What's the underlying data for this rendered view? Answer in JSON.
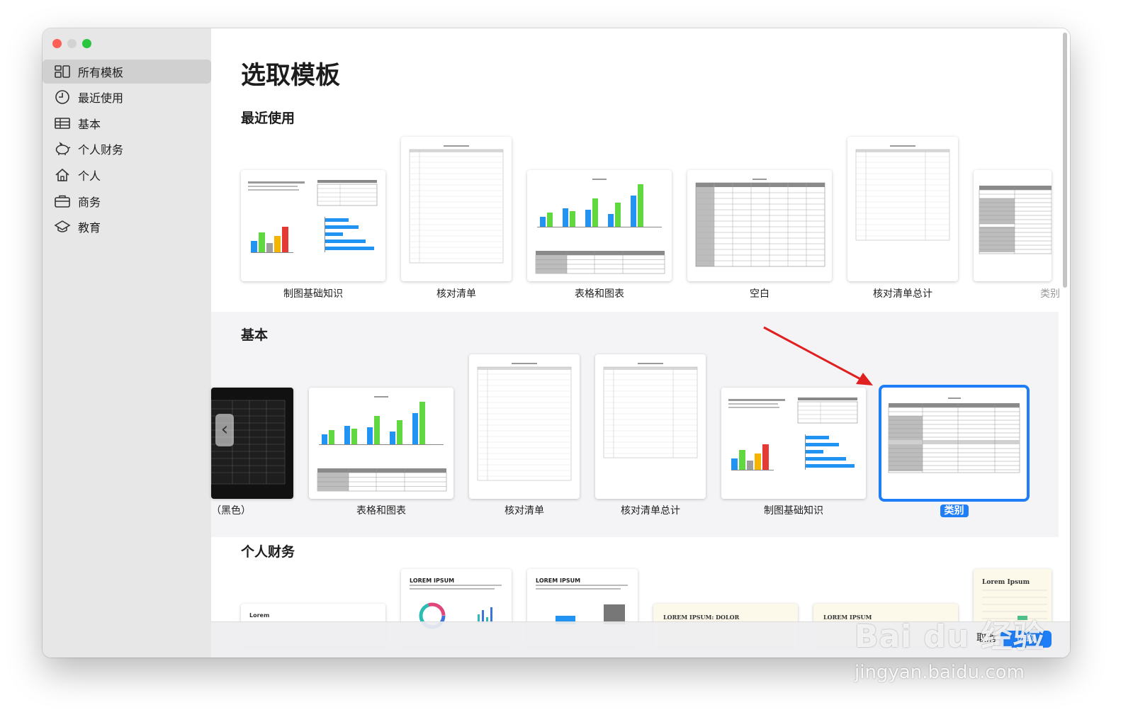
{
  "sidebar": {
    "items": [
      {
        "label": "所有模板",
        "icon": "grid-icon",
        "selected": true
      },
      {
        "label": "最近使用",
        "icon": "clock-icon",
        "selected": false
      },
      {
        "label": "基本",
        "icon": "table-icon",
        "selected": false
      },
      {
        "label": "个人财务",
        "icon": "piggy-bank-icon",
        "selected": false
      },
      {
        "label": "个人",
        "icon": "house-icon",
        "selected": false
      },
      {
        "label": "商务",
        "icon": "briefcase-icon",
        "selected": false
      },
      {
        "label": "教育",
        "icon": "graduation-cap-icon",
        "selected": false
      }
    ]
  },
  "main": {
    "title": "选取模板",
    "sections": {
      "recent": {
        "title": "最近使用",
        "templates": [
          "制图基础知识",
          "核对清单",
          "表格和图表",
          "空白",
          "核对清单总计",
          "类别"
        ]
      },
      "basic": {
        "title": "基本",
        "templates": [
          "（黑色）",
          "表格和图表",
          "核对清单",
          "核对清单总计",
          "制图基础知识",
          "类别"
        ],
        "selected": "类别"
      },
      "personal_finance": {
        "title": "个人财务",
        "thumb_texts": [
          "Lorem",
          "LOREM IPSUM",
          "LOREM IPSUM",
          "LOREM IPSUM: DOLOR",
          "LOREM IPSUM",
          "Lorem Ipsum"
        ]
      }
    }
  },
  "footer": {
    "cancel_label": "取消",
    "choose_label": "选取"
  },
  "watermark": {
    "brand": "Bai du 经验",
    "url": "jingyan.baidu.com"
  },
  "colors": {
    "accent": "#1f7ef5",
    "annotation_arrow": "#e02020",
    "sidebar_bg": "#e7e7e7"
  }
}
